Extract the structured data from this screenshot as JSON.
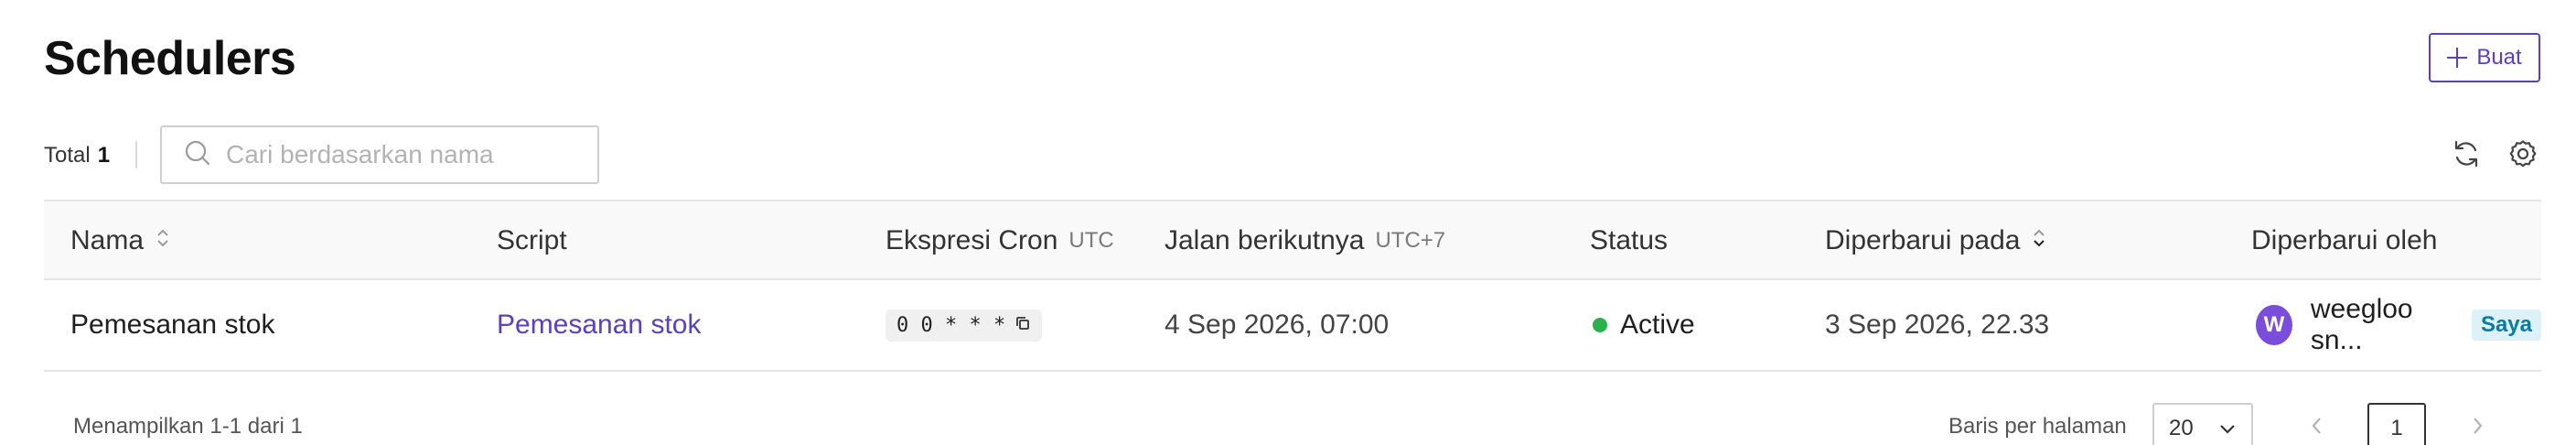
{
  "header": {
    "title": "Schedulers",
    "create_label": "Buat"
  },
  "toolbar": {
    "total_label": "Total",
    "total_count": "1",
    "search_placeholder": "Cari berdasarkan nama",
    "search_value": ""
  },
  "table": {
    "columns": {
      "name": "Nama",
      "script": "Script",
      "cron": "Ekspresi Cron",
      "cron_tz": "UTC",
      "next_run": "Jalan berikutnya",
      "next_run_tz": "UTC+7",
      "status": "Status",
      "updated_at": "Diperbarui pada",
      "updated_by": "Diperbarui oleh"
    },
    "rows": [
      {
        "name": "Pemesanan stok",
        "script": "Pemesanan stok",
        "cron": "0 0 * * *",
        "next_run": "4 Sep 2026, 07:00",
        "status": "Active",
        "updated_at": "3 Sep 2026, 22.33",
        "updated_by": "weegloo sn...",
        "avatar_letter": "W",
        "badge": "Saya"
      }
    ]
  },
  "footer": {
    "showing": "Menampilkan 1-1 dari 1",
    "rows_per_page_label": "Baris per halaman",
    "rows_per_page_value": "20",
    "current_page": "1"
  },
  "colors": {
    "accent": "#5b3fc4",
    "status_active": "#2bb24c",
    "badge_bg": "#dcf1f8",
    "badge_text": "#0b7aa6"
  }
}
